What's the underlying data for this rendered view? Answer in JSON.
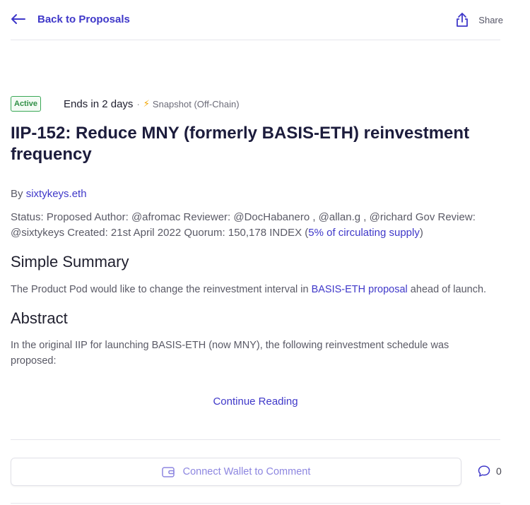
{
  "header": {
    "back_label": "Back to Proposals",
    "share_label": "Share"
  },
  "proposal": {
    "status_badge": "Active",
    "ends_text": "Ends in 2 days",
    "separator": "·",
    "source_label": "Snapshot (Off-Chain)",
    "title": "IIP-152: Reduce MNY (formerly BASIS-ETH) reinvestment frequency",
    "by_prefix": "By",
    "author": "sixtykeys.eth",
    "status_text": "Status: Proposed Author: @afromac Reviewer: @DocHabanero , @allan.g , @richard Gov Review: @sixtykeys Created: 21st April 2022 Quorum: 150,178 INDEX (",
    "status_link": "5% of circulating supply",
    "status_suffix": ")"
  },
  "summary": {
    "heading": "Simple Summary",
    "text_before": "The Product Pod would like to change the reinvestment interval in ",
    "link": "BASIS-ETH proposal",
    "text_after": " ahead of launch."
  },
  "abstract": {
    "heading": "Abstract",
    "text": "In the original IIP for launching BASIS-ETH (now MNY), the following reinvestment schedule was proposed:"
  },
  "continue_label": "Continue Reading",
  "comment_box": {
    "connect_label": "Connect Wallet to Comment",
    "comment_count": "0"
  },
  "colors": {
    "accent": "#3f38c9",
    "active_green": "#2f8f45",
    "bolt": "#f2a500"
  },
  "icons": [
    "arrow-left-icon",
    "share-icon",
    "lightning-icon",
    "wallet-icon",
    "comment-bubble-icon"
  ]
}
